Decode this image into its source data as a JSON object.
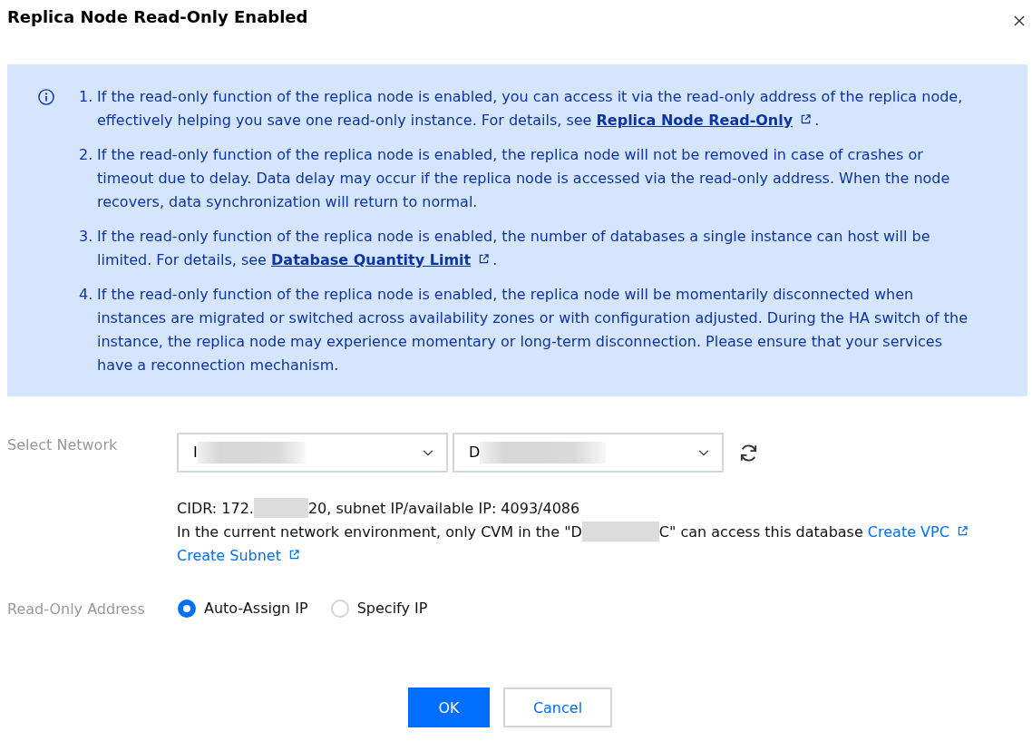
{
  "dialog": {
    "title": "Replica Node Read-Only Enabled"
  },
  "notice": {
    "items": [
      {
        "number": "1.",
        "segments": [
          {
            "kind": "text",
            "text": "If the read-only function of the replica node is enabled, you can access it via the read-only address of the replica node, effectively helping you save one read-only instance. For details, see "
          },
          {
            "kind": "link",
            "text": "Replica Node Read-Only"
          },
          {
            "kind": "text",
            "text": "."
          }
        ]
      },
      {
        "number": "2.",
        "segments": [
          {
            "kind": "text",
            "text": "If the read-only function of the replica node is enabled, the replica node will not be removed in case of crashes or timeout due to delay. Data delay may occur if the replica node is accessed via the read-only address. When the node recovers, data synchronization will return to normal."
          }
        ]
      },
      {
        "number": "3.",
        "segments": [
          {
            "kind": "text",
            "text": "If the read-only function of the replica node is enabled, the number of databases a single instance can host will be limited. For details, see "
          },
          {
            "kind": "link",
            "text": "Database Quantity Limit"
          },
          {
            "kind": "text",
            "text": "."
          }
        ]
      },
      {
        "number": "4.",
        "segments": [
          {
            "kind": "text",
            "text": "If the read-only function of the replica node is enabled, the replica node will be momentarily disconnected when instances are migrated or switched across availability zones or with configuration adjusted. During the HA switch of the instance, the replica node may experience momentary or long-term disconnection. Please ensure that your services have a reconnection mechanism."
          }
        ]
      }
    ]
  },
  "network": {
    "label": "Select Network",
    "selects": [
      {
        "value": "I",
        "redacted": true
      },
      {
        "value": "D",
        "redacted": true
      }
    ],
    "details": [
      {
        "segments": [
          {
            "kind": "text",
            "text": "CIDR: 172."
          },
          {
            "kind": "redacted"
          },
          {
            "kind": "text",
            "text": "20, subnet IP/available IP: 4093/4086"
          }
        ]
      },
      {
        "segments": [
          {
            "kind": "text",
            "text": "In the current network environment, only CVM in the \"D"
          },
          {
            "kind": "redacted"
          },
          {
            "kind": "text",
            "text": "C\" can access this database "
          },
          {
            "kind": "link",
            "text": "Create VPC"
          },
          {
            "kind": "link",
            "text": "Create Subnet"
          }
        ]
      }
    ]
  },
  "read_only_address": {
    "label": "Read-Only Address",
    "options": [
      {
        "label": "Auto-Assign IP",
        "selected": true
      },
      {
        "label": "Specify IP",
        "selected": false
      }
    ]
  },
  "buttons": [
    {
      "label": "OK",
      "kind": "primary"
    },
    {
      "label": "Cancel",
      "kind": "secondary"
    }
  ]
}
